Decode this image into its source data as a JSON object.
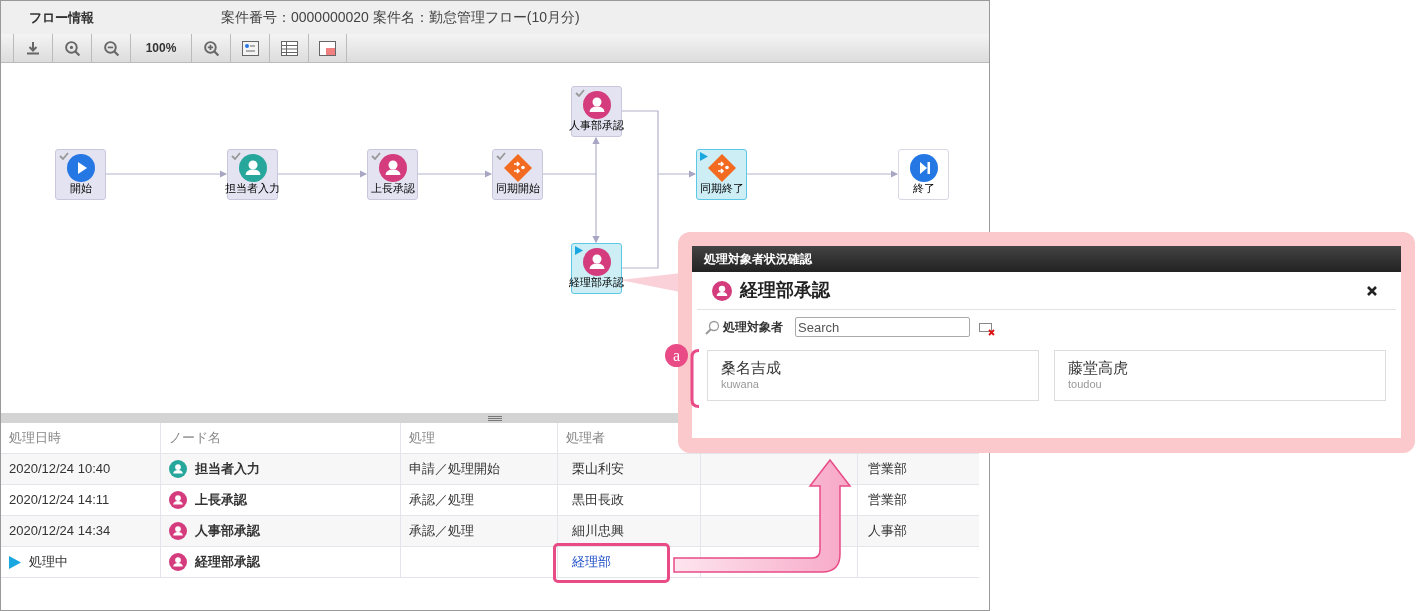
{
  "header": {
    "title": "フロー情報",
    "case_info": "案件番号：0000000020 案件名：勤怠管理フロー(10月分)"
  },
  "toolbar": [
    {
      "kind": "download"
    },
    {
      "kind": "zoom-fit"
    },
    {
      "kind": "zoom-out"
    },
    {
      "kind": "zoom-level",
      "label": "100%"
    },
    {
      "kind": "zoom-in"
    },
    {
      "kind": "node-view"
    },
    {
      "kind": "table-view"
    },
    {
      "kind": "window-view"
    }
  ],
  "flow": {
    "nodes": [
      {
        "label": "開始",
        "kind": "start",
        "done": true,
        "active": false
      },
      {
        "label": "担当者入力",
        "kind": "applicant",
        "done": true,
        "active": false
      },
      {
        "label": "上長承認",
        "kind": "approver",
        "done": true,
        "active": false
      },
      {
        "label": "同期開始",
        "kind": "gateway",
        "done": true,
        "active": false
      },
      {
        "label": "人事部承認",
        "kind": "approver",
        "done": true,
        "active": false
      },
      {
        "label": "経理部承認",
        "kind": "approver",
        "done": false,
        "active": true
      },
      {
        "label": "同期終了",
        "kind": "gateway",
        "done": false,
        "active": true
      },
      {
        "label": "終了",
        "kind": "end",
        "done": false,
        "active": false
      }
    ]
  },
  "history": {
    "columns": [
      "処理日時",
      "ノード名",
      "処理",
      "処理者"
    ],
    "rows": [
      {
        "date": "2020/12/24 10:40",
        "in_progress": false,
        "node": {
          "label": "担当者入力",
          "kind": "applicant"
        },
        "action": "申請／処理開始",
        "handler": {
          "text": "栗山利安",
          "link": false
        },
        "column_6": "営業部"
      },
      {
        "date": "2020/12/24 14:11",
        "in_progress": false,
        "node": {
          "label": "上長承認",
          "kind": "approver"
        },
        "action": "承認／処理",
        "handler": {
          "text": "黒田長政",
          "link": false
        },
        "column_6": "営業部"
      },
      {
        "date": "2020/12/24 14:34",
        "in_progress": false,
        "node": {
          "label": "人事部承認",
          "kind": "approver"
        },
        "action": "承認／処理",
        "handler": {
          "text": "細川忠興",
          "link": false
        },
        "column_6": "人事部"
      },
      {
        "date": "処理中",
        "in_progress": true,
        "node": {
          "label": "経理部承認",
          "kind": "approver"
        },
        "handler": {
          "text": "経理部",
          "link": true
        }
      }
    ]
  },
  "popup": {
    "title": "処理対象者状況確認",
    "node": {
      "label": "経理部承認",
      "kind": "approver"
    },
    "search_label": "処理対象者",
    "search_placeholder": "Search",
    "users": [
      {
        "name": "桑名吉成",
        "id": "kuwana"
      },
      {
        "name": "藤堂高虎",
        "id": "toudou"
      }
    ]
  },
  "annotation": {
    "label": "a"
  }
}
